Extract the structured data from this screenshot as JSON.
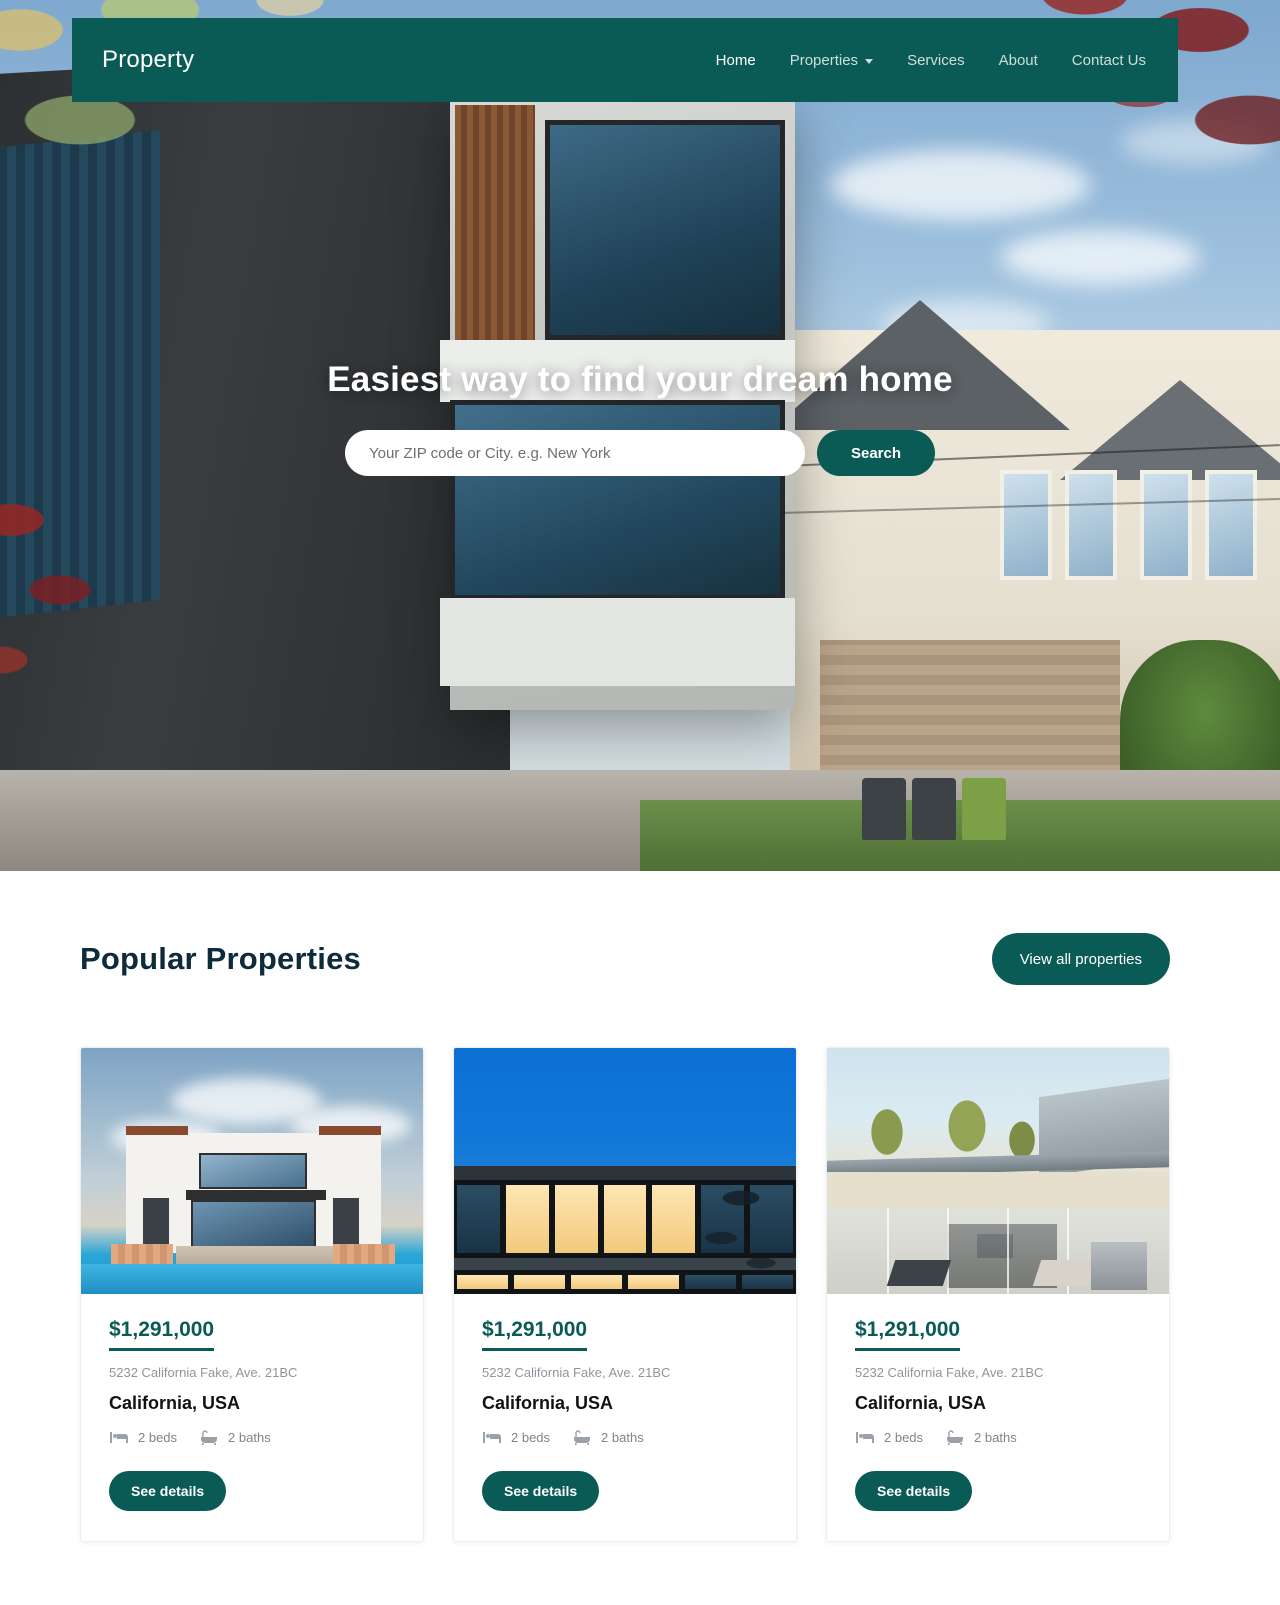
{
  "nav": {
    "brand": "Property",
    "links": [
      {
        "label": "Home",
        "active": true,
        "has_caret": false,
        "icon": ""
      },
      {
        "label": "Properties",
        "active": false,
        "has_caret": true,
        "icon": "chevron-down-icon"
      },
      {
        "label": "Services",
        "active": false,
        "has_caret": false,
        "icon": ""
      },
      {
        "label": "About",
        "active": false,
        "has_caret": false,
        "icon": ""
      },
      {
        "label": "Contact Us",
        "active": false,
        "has_caret": false,
        "icon": ""
      }
    ]
  },
  "hero": {
    "title": "Easiest way to find your dream home",
    "search_placeholder": "Your ZIP code or City. e.g. New York",
    "search_value": "",
    "search_button": "Search"
  },
  "properties_section": {
    "title": "Popular Properties",
    "view_all_label": "View all properties",
    "cards": [
      {
        "price": "$1,291,000",
        "address": "5232 California Fake, Ave. 21BC",
        "location": "California, USA",
        "beds": "2 beds",
        "baths": "2 baths",
        "beds_icon": "bed-icon",
        "baths_icon": "bathtub-icon",
        "cta": "See details",
        "image_alt": "white modern villa with swimming pool"
      },
      {
        "price": "$1,291,000",
        "address": "5232 California Fake, Ave. 21BC",
        "location": "California, USA",
        "beds": "2 beds",
        "baths": "2 baths",
        "beds_icon": "bed-icon",
        "baths_icon": "bathtub-icon",
        "cta": "See details",
        "image_alt": "modern glass house lit at dusk"
      },
      {
        "price": "$1,291,000",
        "address": "5232 California Fake, Ave. 21BC",
        "location": "California, USA",
        "beds": "2 beds",
        "baths": "2 baths",
        "beds_icon": "bed-icon",
        "baths_icon": "bathtub-icon",
        "cta": "See details",
        "image_alt": "modern patio house with glass walls and loungers"
      }
    ]
  },
  "colors": {
    "brand_teal": "#0a5b55",
    "title_dark": "#0d2b3a",
    "muted_text": "#8e959c",
    "white": "#ffffff"
  }
}
